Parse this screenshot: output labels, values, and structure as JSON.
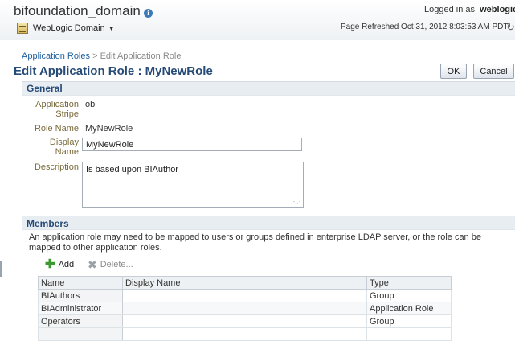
{
  "header": {
    "domain_name": "bifoundation_domain",
    "logged_in_prefix": "Logged in as",
    "logged_in_user": "weblogic",
    "weblogic_menu_label": "WebLogic Domain",
    "page_refreshed": "Page Refreshed Oct 31, 2012 8:03:53 AM PDT"
  },
  "breadcrumb": {
    "link": "Application Roles",
    "separator": ">",
    "current": "Edit Application Role"
  },
  "page_title": "Edit Application Role : MyNewRole",
  "buttons": {
    "ok": "OK",
    "cancel": "Cancel"
  },
  "general": {
    "section_title": "General",
    "application_stripe_label": "Application Stripe",
    "application_stripe_value": "obi",
    "role_name_label": "Role Name",
    "role_name_value": "MyNewRole",
    "display_name_label": "Display Name",
    "display_name_value": "MyNewRole",
    "description_label": "Description",
    "description_value": "Is based upon BIAuthor"
  },
  "members": {
    "section_title": "Members",
    "description": "An application role may need to be mapped to users or groups defined in enterprise LDAP server, or the role can be mapped to other application roles.",
    "add_label": "Add",
    "delete_label": "Delete...",
    "columns": [
      "Name",
      "Display Name",
      "Type"
    ],
    "rows": [
      {
        "name": "BIAuthors",
        "display_name": "",
        "type": "Group"
      },
      {
        "name": "BIAdministrator",
        "display_name": "",
        "type": "Application Role"
      },
      {
        "name": "Operators",
        "display_name": "",
        "type": "Group"
      }
    ]
  },
  "colors": {
    "title_blue": "#274b77",
    "link_blue": "#1f5fa0",
    "label_brown": "#7a6a3a",
    "add_green": "#3a9a2f"
  }
}
